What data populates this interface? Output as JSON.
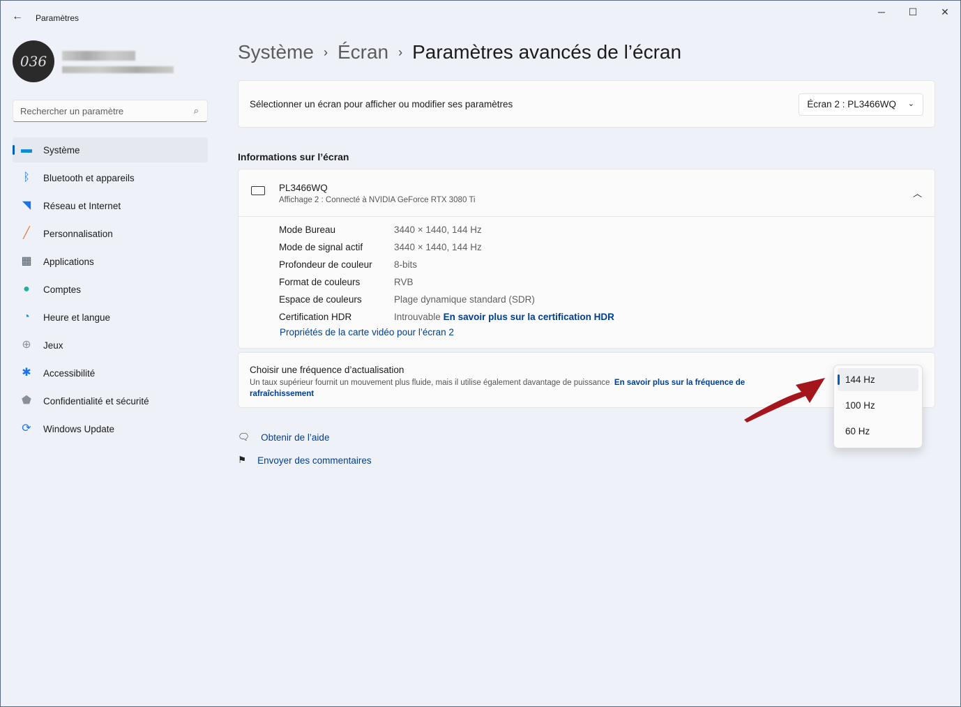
{
  "window": {
    "title": "Paramètres",
    "minimize": "─",
    "maximize": "☐",
    "close": "✕",
    "back": "←"
  },
  "user": {
    "avatar_text": "036"
  },
  "search": {
    "placeholder": "Rechercher un paramètre"
  },
  "sidebar": {
    "items": [
      {
        "label": "Système",
        "icon": "monitor-icon",
        "glyph": "▬",
        "color": "#0e8ad8"
      },
      {
        "label": "Bluetooth et appareils",
        "icon": "bluetooth-icon",
        "glyph": "ᛒ",
        "color": "#1a73e8"
      },
      {
        "label": "Réseau et Internet",
        "icon": "wifi-icon",
        "glyph": "◥",
        "color": "#1a73e8"
      },
      {
        "label": "Personnalisation",
        "icon": "brush-icon",
        "glyph": "╱",
        "color": "#e07a3a"
      },
      {
        "label": "Applications",
        "icon": "apps-icon",
        "glyph": "▦",
        "color": "#4a5563"
      },
      {
        "label": "Comptes",
        "icon": "account-icon",
        "glyph": "●",
        "color": "#1fae9a"
      },
      {
        "label": "Heure et langue",
        "icon": "clock-globe-icon",
        "glyph": "◔",
        "color": "#2a8ad8"
      },
      {
        "label": "Jeux",
        "icon": "gamepad-icon",
        "glyph": "⊕",
        "color": "#8a9099"
      },
      {
        "label": "Accessibilité",
        "icon": "accessibility-icon",
        "glyph": "✱",
        "color": "#1a73e8"
      },
      {
        "label": "Confidentialité et sécurité",
        "icon": "shield-icon",
        "glyph": "⬟",
        "color": "#8a9099"
      },
      {
        "label": "Windows Update",
        "icon": "update-icon",
        "glyph": "⟳",
        "color": "#1a73e8"
      }
    ]
  },
  "breadcrumb": [
    "Système",
    "Écran",
    "Paramètres avancés de l’écran"
  ],
  "breadcrumb_sep": "›",
  "select_display": {
    "label": "Sélectionner un écran pour afficher ou modifier ses paramètres",
    "value": "Écran 2 : PL3466WQ"
  },
  "info": {
    "section_title": "Informations sur l’écran",
    "name": "PL3466WQ",
    "subtitle": "Affichage 2 : Connecté à NVIDIA GeForce RTX 3080 Ti",
    "rows": [
      {
        "k": "Mode Bureau",
        "v": "3440 × 1440, 144 Hz"
      },
      {
        "k": "Mode de signal actif",
        "v": "3440 × 1440, 144 Hz"
      },
      {
        "k": "Profondeur de couleur",
        "v": "8-bits"
      },
      {
        "k": "Format de couleurs",
        "v": "RVB"
      },
      {
        "k": "Espace de couleurs",
        "v": "Plage dynamique standard (SDR)"
      },
      {
        "k": "Certification HDR",
        "v": "Introuvable",
        "link": "En savoir plus sur la certification HDR"
      }
    ],
    "adapter_link": "Propriétés de la carte vidéo pour l’écran 2"
  },
  "refresh": {
    "title": "Choisir une fréquence d’actualisation",
    "desc": "Un taux supérieur fournit un mouvement plus fluide, mais il utilise également davantage de puissance",
    "link": "En savoir plus sur la fréquence de rafraîchissement",
    "options": [
      "144 Hz",
      "100 Hz",
      "60 Hz"
    ],
    "selected": "144 Hz"
  },
  "footer": {
    "help": "Obtenir de l’aide",
    "feedback": "Envoyer des commentaires"
  },
  "colors": {
    "accent": "#005fb8",
    "arrow": "#a5161c"
  }
}
